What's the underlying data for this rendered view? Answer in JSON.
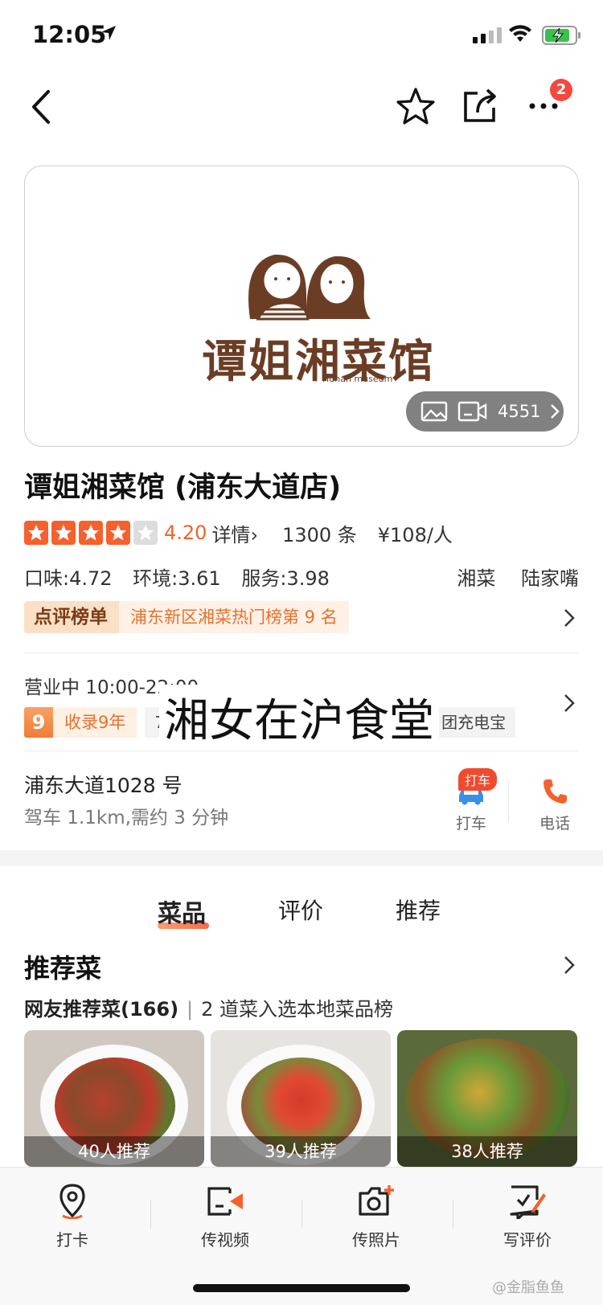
{
  "status_bar": {
    "time": "12:05"
  },
  "nav": {
    "badge_count": "2"
  },
  "hero": {
    "logo_text": "谭姐湘菜馆",
    "logo_sub": "Hunan museum",
    "media_count": "4551"
  },
  "shop": {
    "title": "谭姐湘菜馆 (浦东大道店)",
    "rating": 4.2,
    "score": "4.20",
    "detail_link": "详情",
    "reviews": "1300 条",
    "price": "¥108/人",
    "subscores": [
      "口味:4.72",
      "环境:3.61",
      "服务:3.98"
    ],
    "categories": [
      "湘菜",
      "陆家嘴"
    ],
    "rank_label": "点评榜单",
    "rank_text": "浦东新区湘菜热门榜第 9 名"
  },
  "info": {
    "open_status": "营业中  10:00-22:00",
    "nine": "9",
    "years_tag": "收录9年",
    "grey_tag_left": "7",
    "grey_tag_right": "团充电宝",
    "overlay_text": "湘女在沪食堂",
    "address": "浦东大道1028 号",
    "drive_info": "驾车 1.1km,需约 3 分钟",
    "taxi_badge": "打车",
    "taxi_label": "打车",
    "phone_label": "电话"
  },
  "tabs": [
    {
      "label": "菜品"
    },
    {
      "label": "评价"
    },
    {
      "label": "推荐"
    }
  ],
  "recommend": {
    "title": "推荐菜",
    "sub_bold": "网友推荐菜(166)",
    "sub_sep": "|",
    "sub_rest": "2 道菜入选本地菜品榜",
    "dishes": [
      {
        "caption": "40人推荐"
      },
      {
        "caption": "39人推荐"
      },
      {
        "caption": "38人推荐"
      }
    ]
  },
  "bottom_bar": [
    {
      "label": "打卡"
    },
    {
      "label": "传视频"
    },
    {
      "label": "传照片"
    },
    {
      "label": "写评价"
    }
  ],
  "watermark": "@金脂鱼鱼",
  "colors": {
    "accent": "#f5612d",
    "rank_bg": "#fbe0c8",
    "brand_brown": "#6b3d24"
  }
}
